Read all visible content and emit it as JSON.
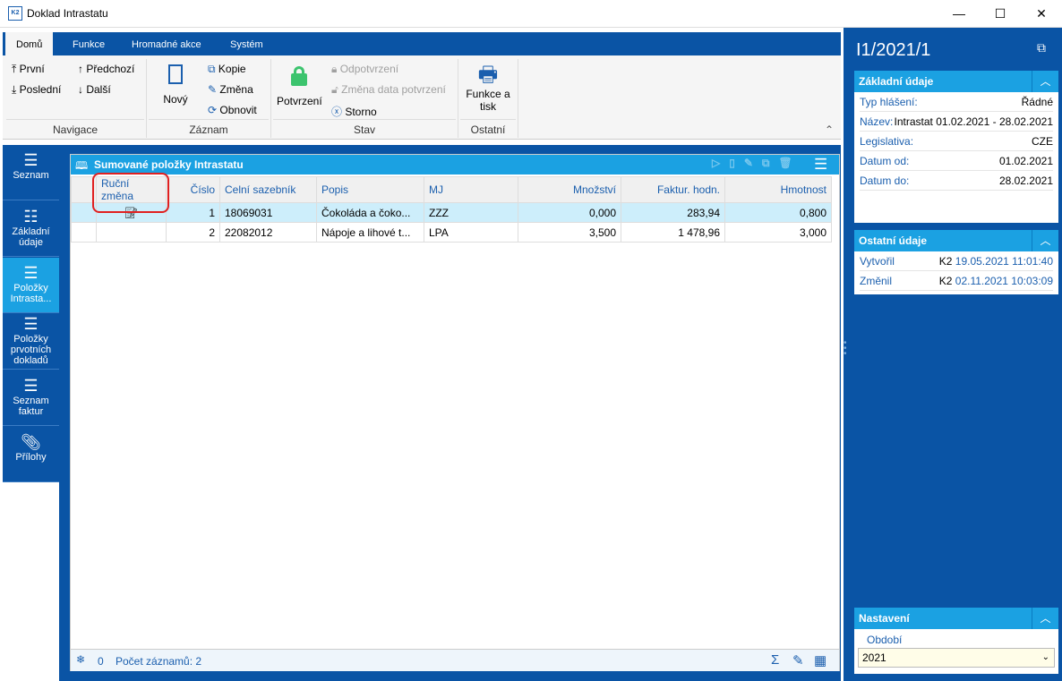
{
  "window": {
    "title": "Doklad Intrastatu",
    "minimize": "—",
    "maximize": "☐",
    "close": "✕",
    "logo": "K2"
  },
  "ribbon": {
    "tabs": [
      "Domů",
      "Funkce",
      "Hromadné akce",
      "Systém"
    ],
    "navigace": {
      "label": "Navigace",
      "prvni": "První",
      "predchozi": "Předchozí",
      "posledni": "Poslední",
      "dalsi": "Další"
    },
    "zaznam": {
      "label": "Záznam",
      "novy": "Nový",
      "kopie": "Kopie",
      "zmena": "Změna",
      "obnovit": "Obnovit"
    },
    "stav": {
      "label": "Stav",
      "potvrzeni": "Potvrzení",
      "odpotvrzeni": "Odpotvrzení",
      "zmena_data": "Změna data potvrzení",
      "storno": "Storno"
    },
    "ostatni": {
      "label": "Ostatní",
      "funkce": "Funkce a tisk"
    }
  },
  "leftnav": [
    {
      "label": "Seznam"
    },
    {
      "label": "Základní údaje"
    },
    {
      "label": "Položky Intrasta..."
    },
    {
      "label": "Položky prvotních dokladů"
    },
    {
      "label": "Seznam faktur"
    },
    {
      "label": "Přílohy"
    }
  ],
  "grid": {
    "title": "Sumované položky Intrastatu",
    "columns": [
      "Ruční změna",
      "Číslo",
      "Celní sazebník",
      "Popis",
      "MJ",
      "Množství",
      "Faktur. hodn.",
      "Hmotnost"
    ],
    "rows": [
      {
        "cislo": "1",
        "sazebnik": "18069031",
        "popis": "Čokoláda a čoko...",
        "mj": "ZZZ",
        "mnozstvi": "0,000",
        "faktur": "283,94",
        "hmotnost": "0,800",
        "rucni": true
      },
      {
        "cislo": "2",
        "sazebnik": "22082012",
        "popis": "Nápoje a lihové t...",
        "mj": "LPA",
        "mnozstvi": "3,500",
        "faktur": "1 478,96",
        "hmotnost": "3,000",
        "rucni": false
      }
    ],
    "footer": {
      "count_zero": "0",
      "records": "Počet záznamů: 2"
    }
  },
  "right": {
    "doc_id": "I1/2021/1",
    "zakladni": {
      "title": "Základní údaje",
      "rows": [
        {
          "k": "Typ hlášení:",
          "v": "Řádné"
        },
        {
          "k": "Název:",
          "v": "Intrastat 01.02.2021 - 28.02.2021"
        },
        {
          "k": "Legislativa:",
          "v": "CZE"
        },
        {
          "k": "Datum od:",
          "v": "01.02.2021"
        },
        {
          "k": "Datum do:",
          "v": "28.02.2021"
        }
      ]
    },
    "ostatni": {
      "title": "Ostatní údaje",
      "rows": [
        {
          "k": "Vytvořil",
          "u": "K2",
          "v": "19.05.2021 11:01:40"
        },
        {
          "k": "Změnil",
          "u": "K2",
          "v": "02.11.2021 10:03:09"
        }
      ]
    },
    "nastaveni": {
      "title": "Nastavení",
      "obdobi_label": "Období",
      "obdobi_value": "2021"
    }
  },
  "colors": {
    "brand_blue": "#0a54a5",
    "accent_cyan": "#1ba1e2",
    "confirm_green": "#3cc46e",
    "highlight_red": "#e02020"
  }
}
